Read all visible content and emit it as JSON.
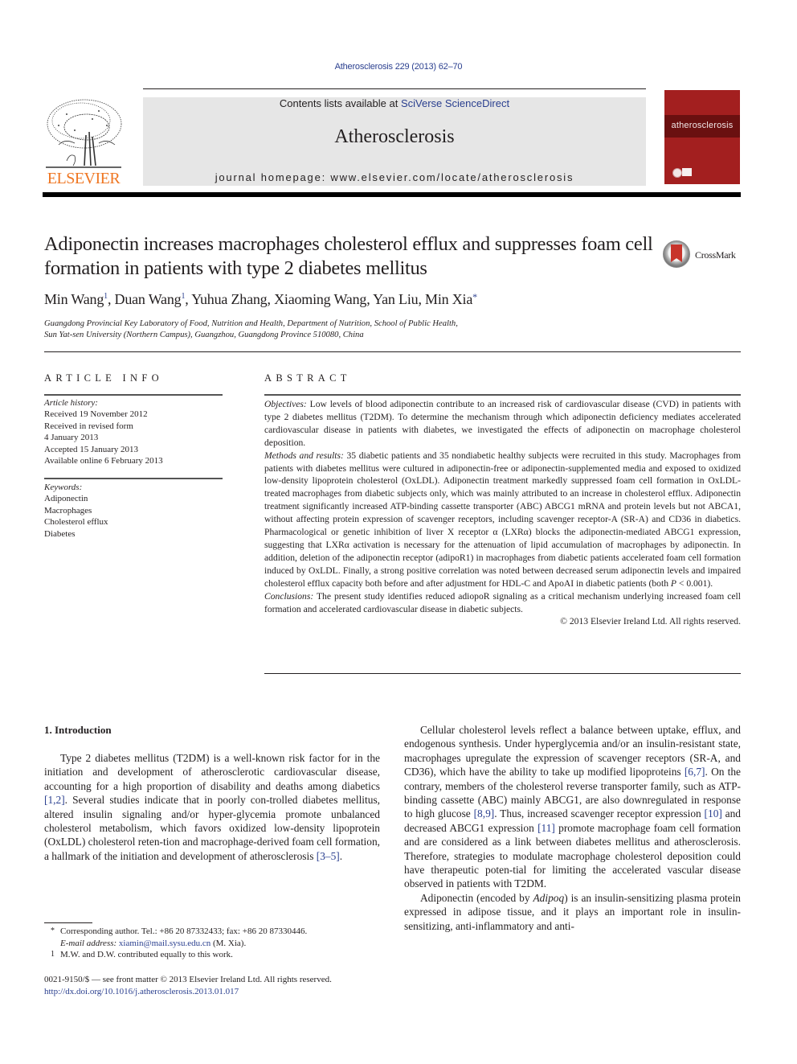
{
  "header": {
    "citation": "Atherosclerosis 229 (2013) 62–70",
    "contents_prefix": "Contents lists available at ",
    "contents_link": "SciVerse ScienceDirect",
    "journal_name": "Atherosclerosis",
    "homepage": "journal homepage: www.elsevier.com/locate/atherosclerosis",
    "publisher_logo_text": "ELSEVIER",
    "cover_title": "atherosclerosis",
    "colors": {
      "link": "#2a3f8f",
      "elsevier_orange": "#ef7622",
      "cover_red": "#a31f1f",
      "masthead_gray": "#e6e6e6"
    }
  },
  "article": {
    "title": "Adiponectin increases macrophages cholesterol efflux and suppresses foam cell formation in patients with type 2 diabetes mellitus",
    "crossmark_label": "CrossMark",
    "authors": [
      {
        "name": "Min Wang",
        "mark": "1"
      },
      {
        "name": "Duan Wang",
        "mark": "1"
      },
      {
        "name": "Yuhua Zhang",
        "mark": ""
      },
      {
        "name": "Xiaoming Wang",
        "mark": ""
      },
      {
        "name": "Yan Liu",
        "mark": ""
      },
      {
        "name": "Min Xia",
        "mark": "*"
      }
    ],
    "affiliation_line1": "Guangdong Provincial Key Laboratory of Food, Nutrition and Health, Department of Nutrition, School of Public Health,",
    "affiliation_line2": "Sun Yat-sen University (Northern Campus), Guangzhou, Guangdong Province 510080, China"
  },
  "article_info": {
    "heading": "ARTICLE INFO",
    "history_label": "Article history:",
    "history": [
      "Received 19 November 2012",
      "Received in revised form",
      "4 January 2013",
      "Accepted 15 January 2013",
      "Available online 6 February 2013"
    ],
    "keywords_label": "Keywords:",
    "keywords": [
      "Adiponectin",
      "Macrophages",
      "Cholesterol efflux",
      "Diabetes"
    ]
  },
  "abstract": {
    "heading": "ABSTRACT",
    "objectives_label": "Objectives:",
    "objectives": " Low levels of blood adiponectin contribute to an increased risk of cardiovascular disease (CVD) in patients with type 2 diabetes mellitus (T2DM). To determine the mechanism through which adiponectin deficiency mediates accelerated cardiovascular disease in patients with diabetes, we investigated the effects of adiponectin on macrophage cholesterol deposition.",
    "methods_label": "Methods and results:",
    "methods_part1": " 35 diabetic patients and 35 nondiabetic healthy subjects were recruited in this study. Macrophages from patients with diabetes mellitus were cultured in adiponectin-free or adiponectin-supplemented media and exposed to oxidized low-density lipoprotein cholesterol (OxLDL). Adiponectin treatment markedly suppressed foam cell formation in OxLDL-treated macrophages from diabetic subjects only, which was mainly attributed to an increase in cholesterol efflux. Adiponectin treatment significantly increased ATP-binding cassette transporter (ABC) ABCG1 mRNA and protein levels but not ABCA1, without affecting protein expression of scavenger receptors, including scavenger receptor-A (SR-A) and CD36 in diabetics. Pharmacological or genetic inhibition of liver X receptor α (LXRα) blocks the adiponectin-mediated ABCG1 expression, suggesting that LXRα activation is necessary for the attenuation of lipid accumulation of macrophages by adiponectin. In addition, deletion of the adiponectin receptor (adipoR1) in macrophages from diabetic patients accelerated foam cell formation induced by OxLDL. Finally, a strong positive correlation was noted between decreased serum adiponectin levels and impaired cholesterol efflux capacity both before and after adjustment for HDL-C and ApoAI in diabetic patients (both ",
    "methods_p": "P",
    "methods_part2": " < 0.001).",
    "conclusions_label": "Conclusions:",
    "conclusions": " The present study identifies reduced adiopoR signaling as a critical mechanism underlying increased foam cell formation and accelerated cardiovascular disease in diabetic subjects.",
    "copyright": "© 2013 Elsevier Ireland Ltd. All rights reserved."
  },
  "body": {
    "section_heading": "1.  Introduction",
    "left_p1_a": "Type 2 diabetes mellitus (T2DM) is a well-known risk factor for in the initiation and development of atherosclerotic cardiovascular disease, accounting for a high proportion of disability and deaths among diabetics ",
    "left_ref1": "[1,2]",
    "left_p1_b": ". Several studies indicate that in poorly con-trolled diabetes mellitus, altered insulin signaling and/or hyper-glycemia promote unbalanced cholesterol metabolism, which favors oxidized low-density lipoprotein (OxLDL) cholesterol reten-tion and macrophage-derived foam cell formation, a hallmark of the initiation and development of atherosclerosis ",
    "left_ref2": "[3–5]",
    "left_p1_c": ".",
    "right_p1_a": "Cellular cholesterol levels reflect a balance between uptake, efflux, and endogenous synthesis. Under hyperglycemia and/or an insulin-resistant state, macrophages upregulate the expression of scavenger receptors (SR-A, and CD36), which have the ability to take up modified lipoproteins ",
    "right_ref1": "[6,7]",
    "right_p1_b": ". On the contrary, members of the cholesterol reverse transporter family, such as ATP-binding cassette (ABC) mainly ABCG1, are also downregulated in response to high glucose ",
    "right_ref2": "[8,9]",
    "right_p1_c": ". Thus, increased scavenger receptor expression ",
    "right_ref3": "[10]",
    "right_p1_d": " and decreased ABCG1 expression ",
    "right_ref4": "[11]",
    "right_p1_e": " promote macrophage foam cell formation and are considered as a link between diabetes mellitus and atherosclerosis. Therefore, strategies to modulate macrophage cholesterol deposition could have therapeutic poten-tial for limiting the accelerated vascular disease observed in patients with T2DM.",
    "right_p2_a": "Adiponectin (encoded by ",
    "right_p2_gene": "Adipoq",
    "right_p2_b": ") is an insulin-sensitizing plasma protein expressed in adipose tissue, and it plays an important role in insulin-sensitizing, anti-inflammatory and anti-"
  },
  "footnotes": {
    "star_mark": "*",
    "corresponding": "Corresponding author. Tel.: +86 20 87332433; fax: +86 20 87330446.",
    "email_label": "E-mail address:",
    "email": "xiamin@mail.sysu.edu.cn",
    "email_suffix": " (M. Xia).",
    "one_mark": "1",
    "equal_contrib": "M.W. and D.W. contributed equally to this work.",
    "front_matter": "0021-9150/$ — see front matter © 2013 Elsevier Ireland Ltd. All rights reserved.",
    "doi": "http://dx.doi.org/10.1016/j.atherosclerosis.2013.01.017"
  }
}
